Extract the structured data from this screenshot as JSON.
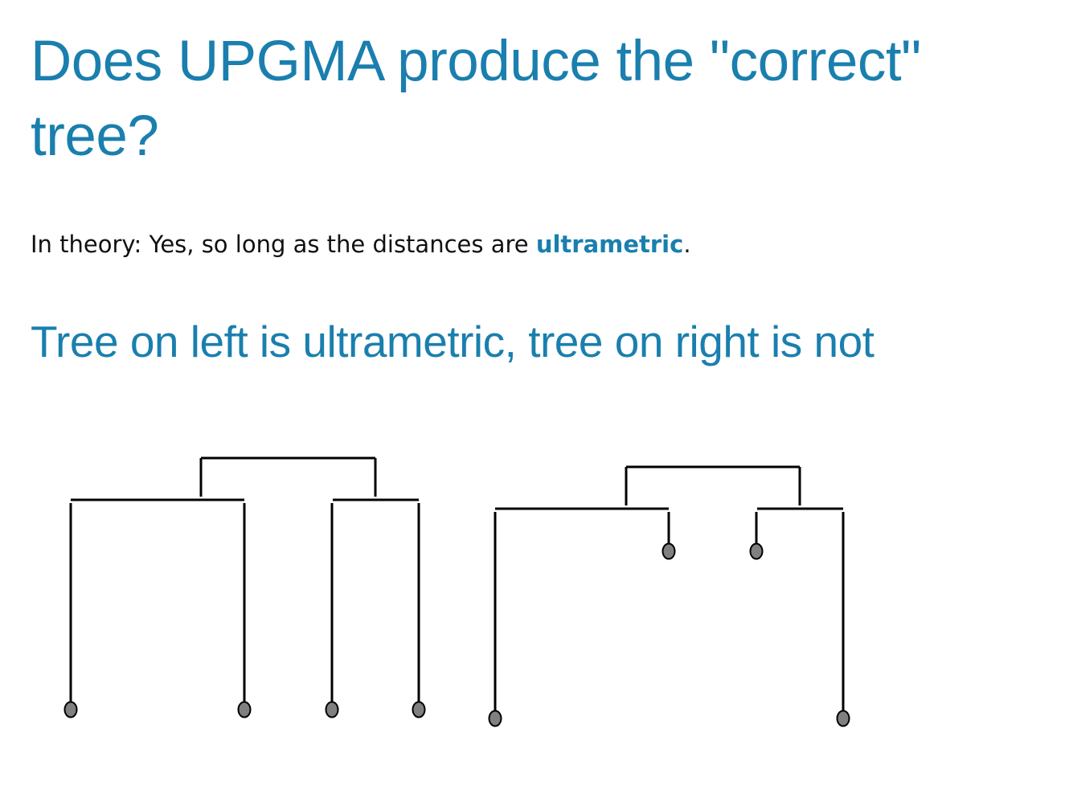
{
  "slide": {
    "title": "Does UPGMA produce the \"correct\" tree?",
    "intro": {
      "prefix": "In theory: Yes, so long as the distances are ",
      "term": "ultrametric",
      "suffix": "."
    },
    "subtitle": "Tree on left is ultrametric, tree on right is not"
  },
  "colors": {
    "accent": "#1a7fae",
    "text": "#111111",
    "branch": "#000000",
    "leaf_fill": "#808080"
  },
  "trees": [
    {
      "name": "ultrametric-tree",
      "leaf_count": 4,
      "leaf_depths": [
        1,
        1,
        1,
        1
      ]
    },
    {
      "name": "non-ultrametric-tree",
      "leaf_count": 4,
      "leaf_depths": [
        1,
        0.2,
        0.2,
        1
      ]
    }
  ]
}
